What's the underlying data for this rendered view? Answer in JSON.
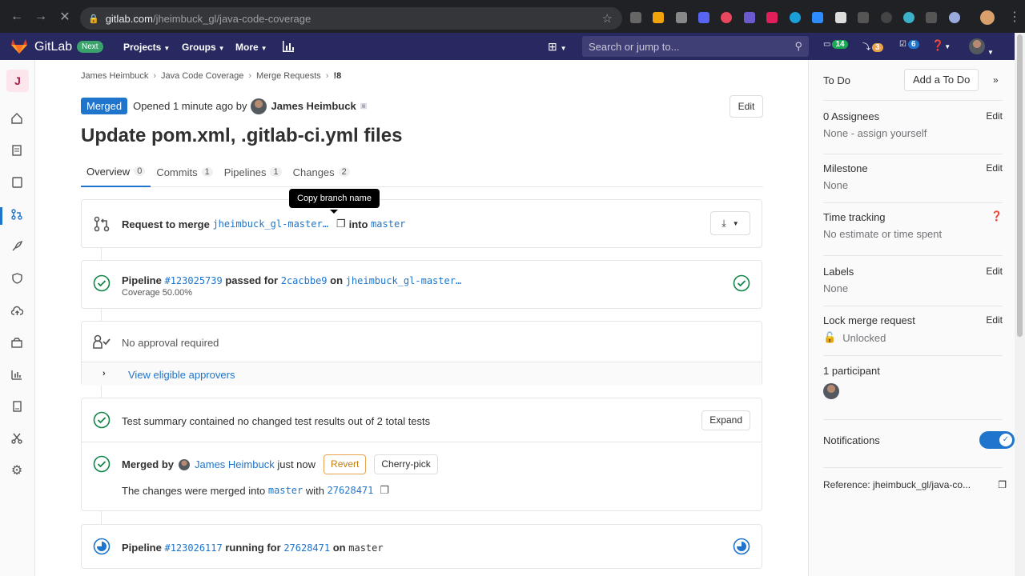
{
  "browser": {
    "url_domain": "gitlab.com",
    "url_path": "/jheimbuck_gl/java-code-coverage"
  },
  "nav": {
    "brand": "GitLab",
    "next_badge": "Next",
    "projects": "Projects",
    "groups": "Groups",
    "more": "More",
    "search_placeholder": "Search or jump to...",
    "issues_count": "14",
    "mr_count": "3",
    "todo_count": "6"
  },
  "left_sidebar": {
    "project_initial": "J"
  },
  "breadcrumb": {
    "items": [
      "James Heimbuck",
      "Java Code Coverage",
      "Merge Requests",
      "!8"
    ]
  },
  "mr": {
    "status": "Merged",
    "opened_text": "Opened 1 minute ago by",
    "author": "James Heimbuck",
    "edit": "Edit",
    "title": "Update pom.xml, .gitlab-ci.yml files",
    "tabs": [
      {
        "label": "Overview",
        "count": "0"
      },
      {
        "label": "Commits",
        "count": "1"
      },
      {
        "label": "Pipelines",
        "count": "1"
      },
      {
        "label": "Changes",
        "count": "2"
      }
    ],
    "tooltip": "Copy branch name",
    "request_prefix": "Request to merge",
    "source_branch": "jheimbuck_gl-master…",
    "into": "into",
    "target_branch": "master"
  },
  "pipeline1": {
    "prefix": "Pipeline",
    "id": "#123025739",
    "status": "passed for",
    "commit": "2cacbbe9",
    "on": "on",
    "branch": "jheimbuck_gl-master…",
    "coverage": "Coverage 50.00%"
  },
  "approval": {
    "text": "No approval required",
    "view_approvers": "View eligible approvers"
  },
  "tests": {
    "summary": "Test summary contained no changed test results out of 2 total tests",
    "expand": "Expand",
    "merged_by_label": "Merged by",
    "merged_by_name": "James Heimbuck",
    "merged_when": "just now",
    "revert": "Revert",
    "cherry_pick": "Cherry-pick",
    "merged_into_prefix": "The changes were merged into",
    "merged_into_branch": "master",
    "with": "with",
    "commit": "27628471"
  },
  "pipeline2": {
    "prefix": "Pipeline",
    "id": "#123026117",
    "status": "running for",
    "commit": "27628471",
    "on": "on",
    "branch": "master"
  },
  "right_sidebar": {
    "todo_label": "To Do",
    "add_todo": "Add a To Do",
    "assignees_title": "0 Assignees",
    "assignees_value": "None - assign yourself",
    "milestone_title": "Milestone",
    "milestone_value": "None",
    "time_title": "Time tracking",
    "time_value": "No estimate or time spent",
    "labels_title": "Labels",
    "labels_value": "None",
    "lock_title": "Lock merge request",
    "lock_value": "Unlocked",
    "participants_title": "1 participant",
    "notifications_title": "Notifications",
    "reference": "Reference: jheimbuck_gl/java-co...",
    "edit": "Edit"
  },
  "colors": {
    "gitlab_nav": "#292961",
    "merged_blue": "#1f75cb",
    "success_green": "#108548",
    "revert_orange": "#c17d10"
  }
}
